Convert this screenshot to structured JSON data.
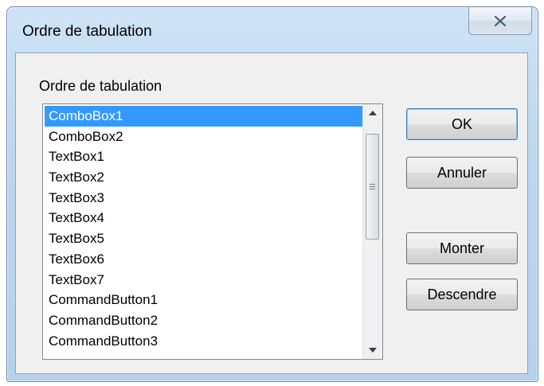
{
  "window": {
    "title": "Ordre de tabulation",
    "close_icon": "close-icon"
  },
  "group": {
    "label": "Ordre de tabulation"
  },
  "list": {
    "selected_index": 0,
    "items": [
      "ComboBox1",
      "ComboBox2",
      "TextBox1",
      "TextBox2",
      "TextBox3",
      "TextBox4",
      "TextBox5",
      "TextBox6",
      "TextBox7",
      "CommandButton1",
      "CommandButton2",
      "CommandButton3"
    ]
  },
  "buttons": {
    "ok": "OK",
    "cancel": "Annuler",
    "move_up": "Monter",
    "move_down": "Descendre"
  },
  "colors": {
    "selection": "#3399ff",
    "dialog_background": "#f0f0f0",
    "frame": "#bcd6ee"
  }
}
